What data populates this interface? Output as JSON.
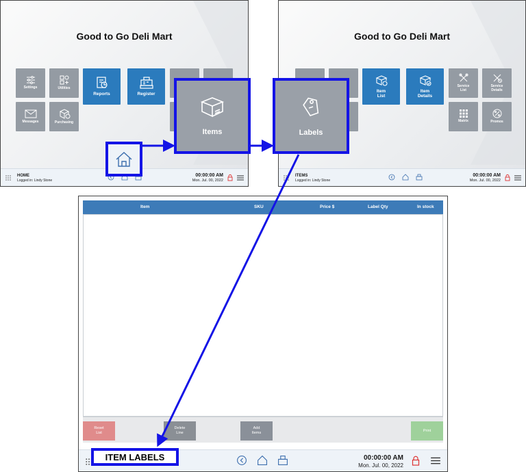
{
  "brand_title": "Good to Go Deli Mart",
  "colors": {
    "tile_blue": "#2b7bbd",
    "tile_grey": "#949ba3",
    "highlight": "#1414e6",
    "header_blue": "#3d7bb8"
  },
  "home": {
    "tiles": {
      "settings": "Settings",
      "utilities": "Utilities",
      "reports": "Reports",
      "register": "Register",
      "messages": "Messages",
      "purchasing": "Purchasing"
    },
    "status": {
      "mode": "HOME",
      "logged_in": "Logged in:  Lindy Stone",
      "clock": "00:00:00 AM",
      "date": "Mon. Jul. 00, 2022"
    }
  },
  "items_screen": {
    "tiles": {
      "item_list": "Item\nList",
      "item_details": "Item\nDetails",
      "service_list": "Service\nList",
      "service_details": "Service\nDetails",
      "matrix": "Matrix",
      "promos": "Promos"
    },
    "status": {
      "mode": "ITEMS",
      "logged_in": "Logged in:  Lindy Stone",
      "clock": "00:00:00 AM",
      "date": "Mon. Jul. 00, 2022"
    }
  },
  "popouts": {
    "items": "Items",
    "labels": "Labels"
  },
  "labels_screen": {
    "columns": {
      "item": "Item",
      "sku": "SKU",
      "price": "Price $",
      "label_qty": "Label Qty",
      "in_stock": "In stock"
    },
    "buttons": {
      "reset_list": "Reset\nList",
      "delete_line": "Delete\nLine",
      "add_items": "Add\nItems",
      "print": "Print"
    },
    "title": "ITEM LABELS",
    "status": {
      "clock": "00:00:00 AM",
      "date": "Mon. Jul. 00, 2022"
    }
  },
  "icons": [
    "home-icon",
    "back-icon",
    "register-icon",
    "lock-icon",
    "menu-icon",
    "grid-icon",
    "box-icon",
    "tag-icon"
  ]
}
